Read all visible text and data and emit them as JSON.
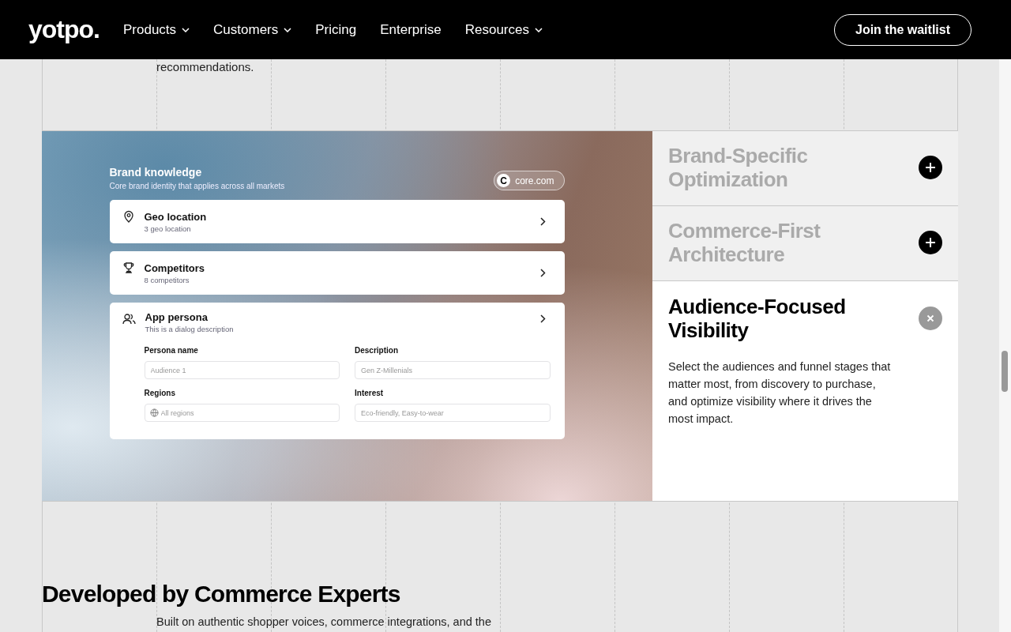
{
  "header": {
    "logo": "yotpo.",
    "nav": [
      {
        "label": "Products",
        "dropdown": true
      },
      {
        "label": "Customers",
        "dropdown": true
      },
      {
        "label": "Pricing",
        "dropdown": false
      },
      {
        "label": "Enterprise",
        "dropdown": false
      },
      {
        "label": "Resources",
        "dropdown": true
      }
    ],
    "cta": "Join the waitlist"
  },
  "intro_tail": "recommendations.",
  "brand_panel": {
    "title": "Brand knowledge",
    "subtitle": "Core brand identity that applies across all markets",
    "domain_badge": {
      "letter": "C",
      "label": "core.com"
    },
    "rows": [
      {
        "title": "Geo location",
        "subtitle": "3 geo location"
      },
      {
        "title": "Competitors",
        "subtitle": "8 competitors"
      }
    ],
    "persona": {
      "title": "App persona",
      "subtitle": "This is a dialog description",
      "fields": [
        {
          "label": "Persona name",
          "placeholder": "Audience 1",
          "globe": false
        },
        {
          "label": "Description",
          "placeholder": "Gen Z-Millenials",
          "globe": false
        },
        {
          "label": "Regions",
          "placeholder": "All regions",
          "globe": true
        },
        {
          "label": "Interest",
          "placeholder": "Eco-friendly, Easy-to-wear",
          "globe": false
        }
      ]
    }
  },
  "accordion": [
    {
      "title": "Brand-Specific Optimization",
      "expanded": false
    },
    {
      "title": "Commerce-First Architecture",
      "expanded": false
    },
    {
      "title": "Audience-Focused Visibility",
      "expanded": true,
      "body": "Select the audiences and funnel stages that matter most, from discovery to purchase, and optimize visibility where it drives the most impact."
    }
  ],
  "section": {
    "heading": "Developed by Commerce Experts",
    "text": "Built on authentic shopper voices, commerce integrations, and the"
  }
}
